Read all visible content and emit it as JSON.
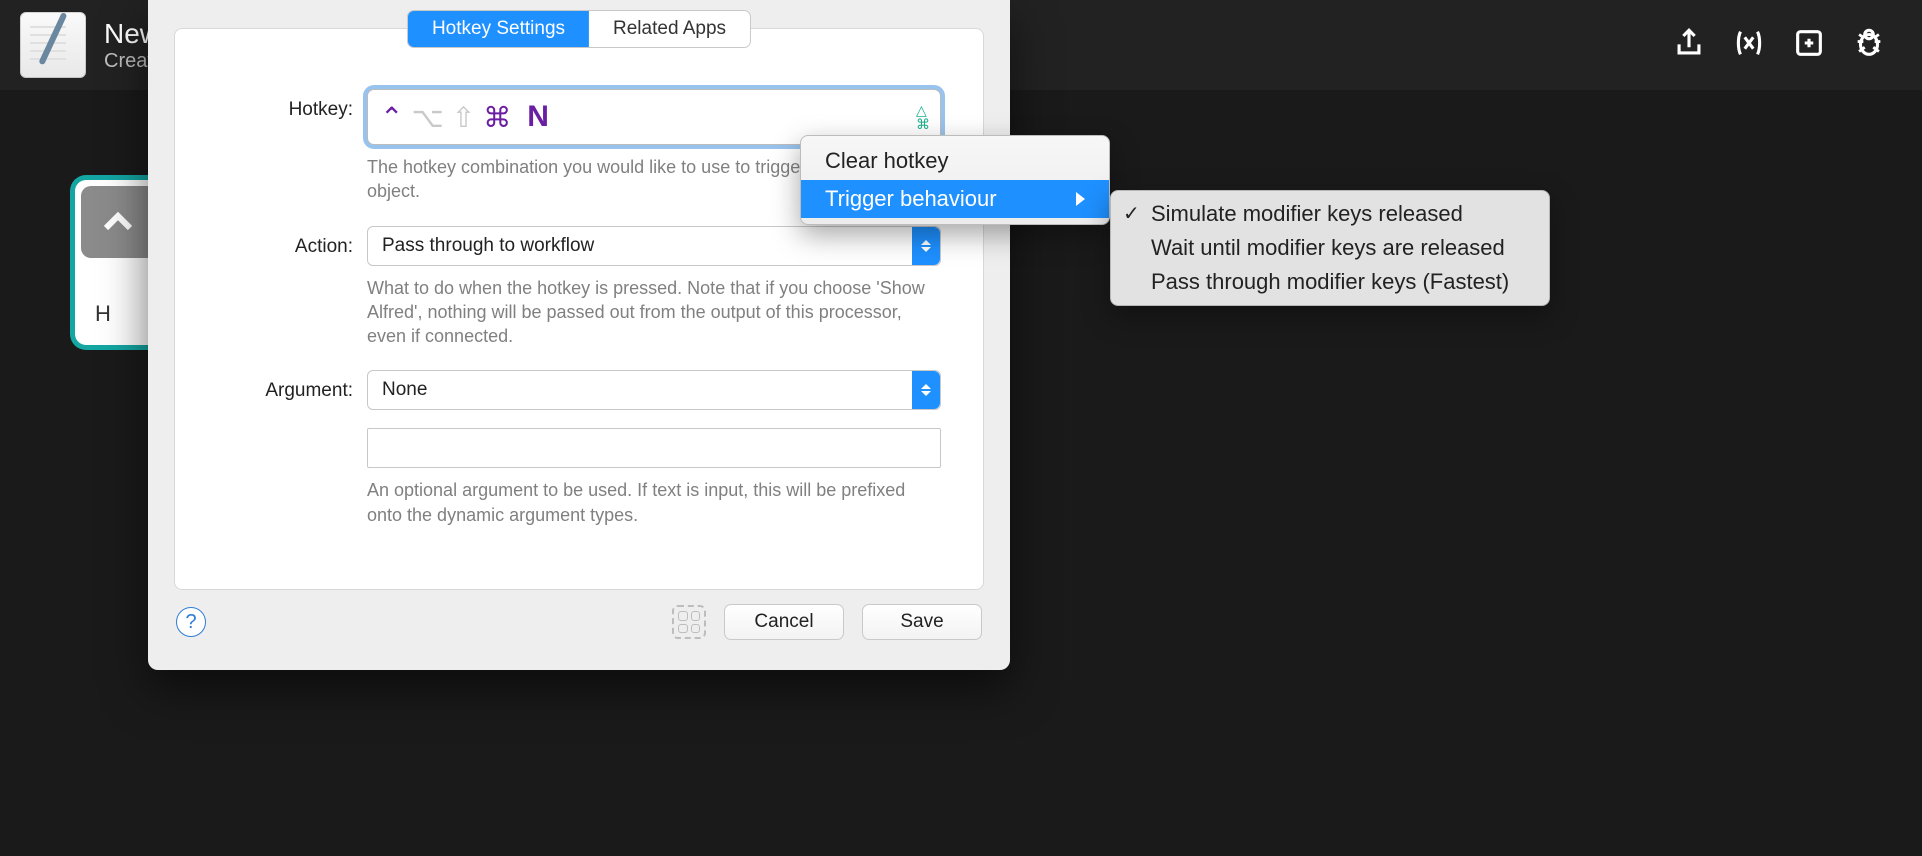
{
  "header": {
    "title": "New",
    "subtitle": "Creat"
  },
  "workflow_node": {
    "letter": "H"
  },
  "sheet": {
    "tabs": {
      "active": "Hotkey Settings",
      "other": "Related Apps"
    },
    "hotkey": {
      "label": "Hotkey:",
      "key": "N",
      "help": "The hotkey combination you would like to use to trigger this workflow object."
    },
    "action": {
      "label": "Action:",
      "value": "Pass through to workflow",
      "help": "What to do when the hotkey is pressed. Note that if you choose 'Show Alfred', nothing will be passed out from the output of this processor, even if connected."
    },
    "argument": {
      "label": "Argument:",
      "value": "None",
      "input_value": "",
      "help": "An optional argument to be used. If text is input, this will be prefixed onto the dynamic argument types."
    },
    "buttons": {
      "cancel": "Cancel",
      "save": "Save"
    }
  },
  "context_menu": {
    "items": [
      "Clear hotkey",
      "Trigger behaviour"
    ],
    "highlighted": 1
  },
  "submenu": {
    "items": [
      "Simulate modifier keys released",
      "Wait until modifier keys are released",
      "Pass through modifier keys (Fastest)"
    ],
    "checked": 0
  }
}
